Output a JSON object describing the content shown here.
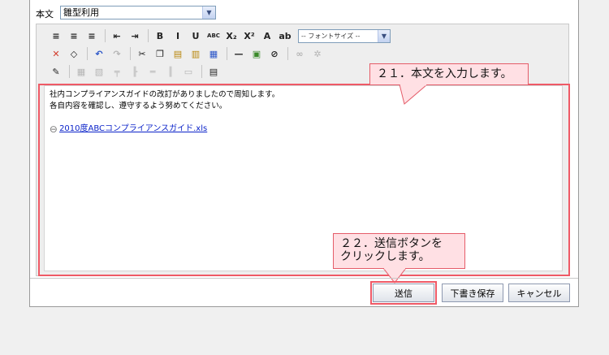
{
  "form": {
    "body_label": "本文",
    "template_value": "雛型利用"
  },
  "toolbar": {
    "row1": [
      {
        "name": "align-left-icon",
        "glyph": "≡"
      },
      {
        "name": "align-center-icon",
        "glyph": "≡"
      },
      {
        "name": "align-right-icon",
        "glyph": "≡"
      },
      {
        "sep": true
      },
      {
        "name": "outdent-icon",
        "glyph": "⇤"
      },
      {
        "name": "indent-icon",
        "glyph": "⇥"
      },
      {
        "sep": true
      },
      {
        "name": "bold-icon",
        "glyph": "B"
      },
      {
        "name": "italic-icon",
        "glyph": "I"
      },
      {
        "name": "underline-icon",
        "glyph": "U"
      },
      {
        "name": "strikethrough-icon",
        "glyph": "ABC"
      },
      {
        "name": "subscript-icon",
        "glyph": "X₂"
      },
      {
        "name": "superscript-icon",
        "glyph": "X²"
      },
      {
        "name": "font-color-icon",
        "glyph": "A"
      },
      {
        "name": "highlight-icon",
        "glyph": "ab"
      }
    ],
    "font_size_placeholder": "-- フォントサイズ --",
    "row2": [
      {
        "name": "delete-icon",
        "glyph": "✕",
        "color": "#d23b2b"
      },
      {
        "name": "eraser-icon",
        "glyph": "◇"
      },
      {
        "sep": true
      },
      {
        "name": "undo-icon",
        "glyph": "↶",
        "color": "#2b55c8"
      },
      {
        "name": "redo-icon",
        "glyph": "↷",
        "disabled": true
      },
      {
        "sep": true
      },
      {
        "name": "cut-icon",
        "glyph": "✂"
      },
      {
        "name": "copy-icon",
        "glyph": "❐"
      },
      {
        "name": "paste-icon",
        "glyph": "▤",
        "color": "#b8860b"
      },
      {
        "name": "paste-text-icon",
        "glyph": "▥",
        "color": "#b8860b"
      },
      {
        "name": "paste-word-icon",
        "glyph": "▦",
        "color": "#2b55c8"
      },
      {
        "sep": true
      },
      {
        "name": "horizontal-rule-icon",
        "glyph": "—"
      },
      {
        "name": "insert-image-icon",
        "glyph": "▣",
        "color": "#3a8a2a"
      },
      {
        "name": "attach-icon",
        "glyph": "⊘"
      },
      {
        "sep": true
      },
      {
        "name": "link-icon",
        "glyph": "∞",
        "disabled": true
      },
      {
        "name": "unlink-icon",
        "glyph": "✲",
        "disabled": true
      }
    ],
    "row3": [
      {
        "name": "edit-icon",
        "glyph": "✎"
      },
      {
        "sep": true
      },
      {
        "name": "table-icon",
        "glyph": "▦",
        "disabled": true
      },
      {
        "name": "table-props-icon",
        "glyph": "▧",
        "disabled": true
      },
      {
        "name": "insert-row-icon",
        "glyph": "╤",
        "disabled": true
      },
      {
        "name": "insert-col-icon",
        "glyph": "╟",
        "disabled": true
      },
      {
        "name": "delete-row-icon",
        "glyph": "═",
        "disabled": true
      },
      {
        "name": "delete-col-icon",
        "glyph": "║",
        "disabled": true
      },
      {
        "name": "merge-cells-icon",
        "glyph": "▭",
        "disabled": true
      },
      {
        "sep": true
      },
      {
        "name": "source-icon",
        "glyph": "▤"
      }
    ]
  },
  "editor": {
    "line1": "社内コンプライアンスガイドの改訂がありましたので周知します。",
    "line2": "各自内容を確認し、遵守するよう努めてください。",
    "attachment_label": "2010度ABCコンプライアンスガイド.xls"
  },
  "callouts": {
    "step21": "２１．本文を入力します。",
    "step22_line1": "２２．送信ボタンを",
    "step22_line2": "クリックします。"
  },
  "buttons": {
    "send": "送信",
    "save_draft": "下書き保存",
    "cancel": "キャンセル"
  },
  "colors": {
    "highlight_red": "#ef5a66",
    "callout_fill": "#ffe0e4",
    "link_blue": "#0b23c9"
  }
}
